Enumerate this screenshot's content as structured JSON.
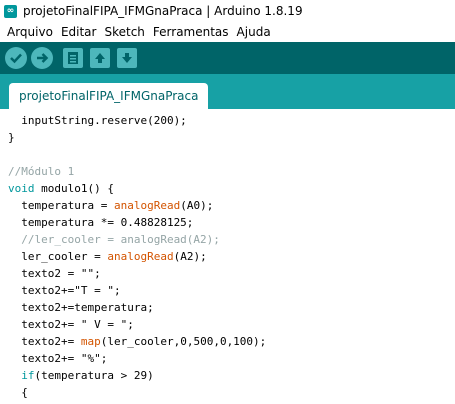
{
  "window": {
    "title": "projetoFinalFIPA_IFMGnaPraca | Arduino 1.8.19"
  },
  "menu": [
    "Arquivo",
    "Editar",
    "Sketch",
    "Ferramentas",
    "Ajuda"
  ],
  "toolbar": {
    "buttons": [
      "verify-icon",
      "upload-icon",
      "new-icon",
      "open-icon",
      "save-icon"
    ]
  },
  "tabs": [
    {
      "label": "projetoFinalFIPA_IFMGnaPraca"
    }
  ],
  "colors": {
    "toolbar": "#006468",
    "tabstrip": "#17a1a5",
    "button": "#4db7bb",
    "keyword": "#00979c",
    "function": "#d35400",
    "comment": "#95a5a6"
  },
  "code": [
    [
      {
        "t": "  inputString.reserve(200);"
      }
    ],
    [
      {
        "t": "}"
      }
    ],
    [
      {
        "t": ""
      }
    ],
    [
      {
        "t": "//Módulo 1",
        "c": "cm"
      }
    ],
    [
      {
        "t": "void",
        "c": "kw"
      },
      {
        "t": " modulo1() {"
      }
    ],
    [
      {
        "t": "  temperatura = "
      },
      {
        "t": "analogRead",
        "c": "fn"
      },
      {
        "t": "(A0);"
      }
    ],
    [
      {
        "t": "  temperatura *= 0.48828125;"
      }
    ],
    [
      {
        "t": "  //ler_cooler = analogRead(A2);",
        "c": "cm"
      }
    ],
    [
      {
        "t": "  ler_cooler = "
      },
      {
        "t": "analogRead",
        "c": "fn"
      },
      {
        "t": "(A2);"
      }
    ],
    [
      {
        "t": "  texto2 = \"\";"
      }
    ],
    [
      {
        "t": "  texto2+=\"T = \";"
      }
    ],
    [
      {
        "t": "  texto2+=temperatura;"
      }
    ],
    [
      {
        "t": "  texto2+= \" V = \";"
      }
    ],
    [
      {
        "t": "  texto2+= "
      },
      {
        "t": "map",
        "c": "fn"
      },
      {
        "t": "(ler_cooler,0,500,0,100);"
      }
    ],
    [
      {
        "t": "  texto2+= \"%\";"
      }
    ],
    [
      {
        "t": "  "
      },
      {
        "t": "if",
        "c": "kw"
      },
      {
        "t": "(temperatura > 29)"
      }
    ],
    [
      {
        "t": "  {"
      }
    ]
  ]
}
